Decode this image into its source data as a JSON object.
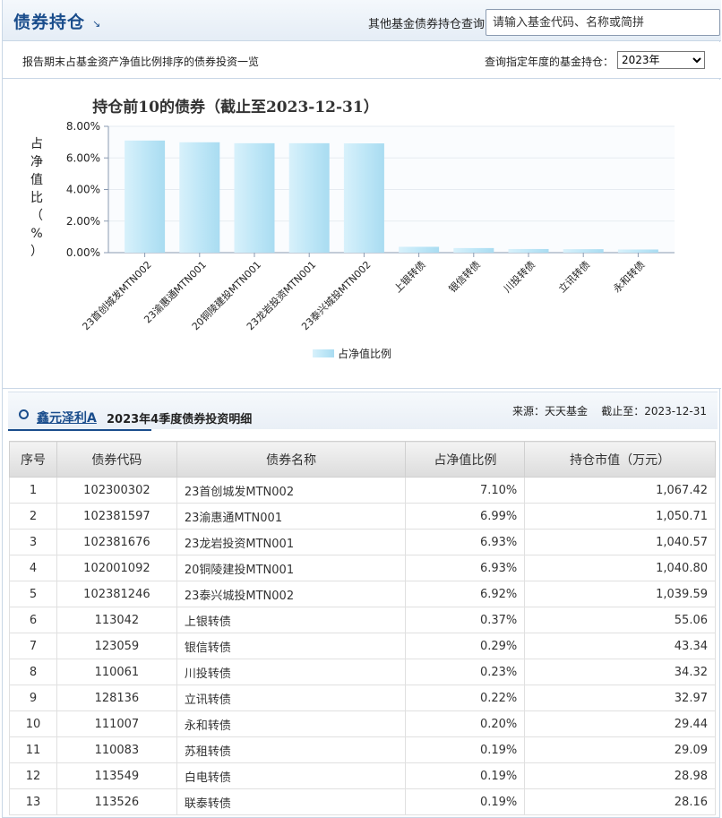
{
  "header": {
    "title": "债券持仓",
    "title_arrow": "↘",
    "query_label": "其他基金债券持仓查询：",
    "query_placeholder": "请输入基金代码、名称或简拼"
  },
  "subbar": {
    "description": "报告期末占基金资产净值比例排序的债券投资一览",
    "year_label": "查询指定年度的基金持仓：",
    "year_selected": "2023年"
  },
  "chart_data": {
    "type": "bar",
    "title": "持仓前10的债券（截止至2023-12-31）",
    "ylabel": "占净值比（%）",
    "ylim": [
      0,
      8
    ],
    "yticks": [
      "0.00%",
      "2.00%",
      "4.00%",
      "6.00%",
      "8.00%"
    ],
    "categories": [
      "23首创城发MTN002",
      "23渝惠通MTN001",
      "20铜陵建投MTN001",
      "23龙岩投资MTN001",
      "23泰兴城投MTN002",
      "上银转债",
      "银信转债",
      "川投转债",
      "立讯转债",
      "永和转债"
    ],
    "series": [
      {
        "name": "占净值比例",
        "values": [
          7.1,
          6.99,
          6.93,
          6.93,
          6.92,
          0.37,
          0.29,
          0.23,
          0.22,
          0.2
        ]
      }
    ],
    "legend_position": "bottom-center",
    "bar_color": "#bfe7f7"
  },
  "detail": {
    "fund_name": "鑫元泽利A",
    "period": "2023年4季度债券投资明细",
    "source": "来源：天天基金    截止至：2023-12-31"
  },
  "table": {
    "headers": [
      "序号",
      "债券代码",
      "债券名称",
      "占净值比例",
      "持仓市值（万元）"
    ],
    "rows": [
      [
        "1",
        "102300302",
        "23首创城发MTN002",
        "7.10%",
        "1,067.42"
      ],
      [
        "2",
        "102381597",
        "23渝惠通MTN001",
        "6.99%",
        "1,050.71"
      ],
      [
        "3",
        "102381676",
        "23龙岩投资MTN001",
        "6.93%",
        "1,040.57"
      ],
      [
        "4",
        "102001092",
        "20铜陵建投MTN001",
        "6.93%",
        "1,040.80"
      ],
      [
        "5",
        "102381246",
        "23泰兴城投MTN002",
        "6.92%",
        "1,039.59"
      ],
      [
        "6",
        "113042",
        "上银转债",
        "0.37%",
        "55.06"
      ],
      [
        "7",
        "123059",
        "银信转债",
        "0.29%",
        "43.34"
      ],
      [
        "8",
        "110061",
        "川投转债",
        "0.23%",
        "34.32"
      ],
      [
        "9",
        "128136",
        "立讯转债",
        "0.22%",
        "32.97"
      ],
      [
        "10",
        "111007",
        "永和转债",
        "0.20%",
        "29.44"
      ],
      [
        "11",
        "110083",
        "苏租转债",
        "0.19%",
        "29.09"
      ],
      [
        "12",
        "113549",
        "白电转债",
        "0.19%",
        "28.98"
      ],
      [
        "13",
        "113526",
        "联泰转债",
        "0.19%",
        "28.16"
      ]
    ]
  }
}
